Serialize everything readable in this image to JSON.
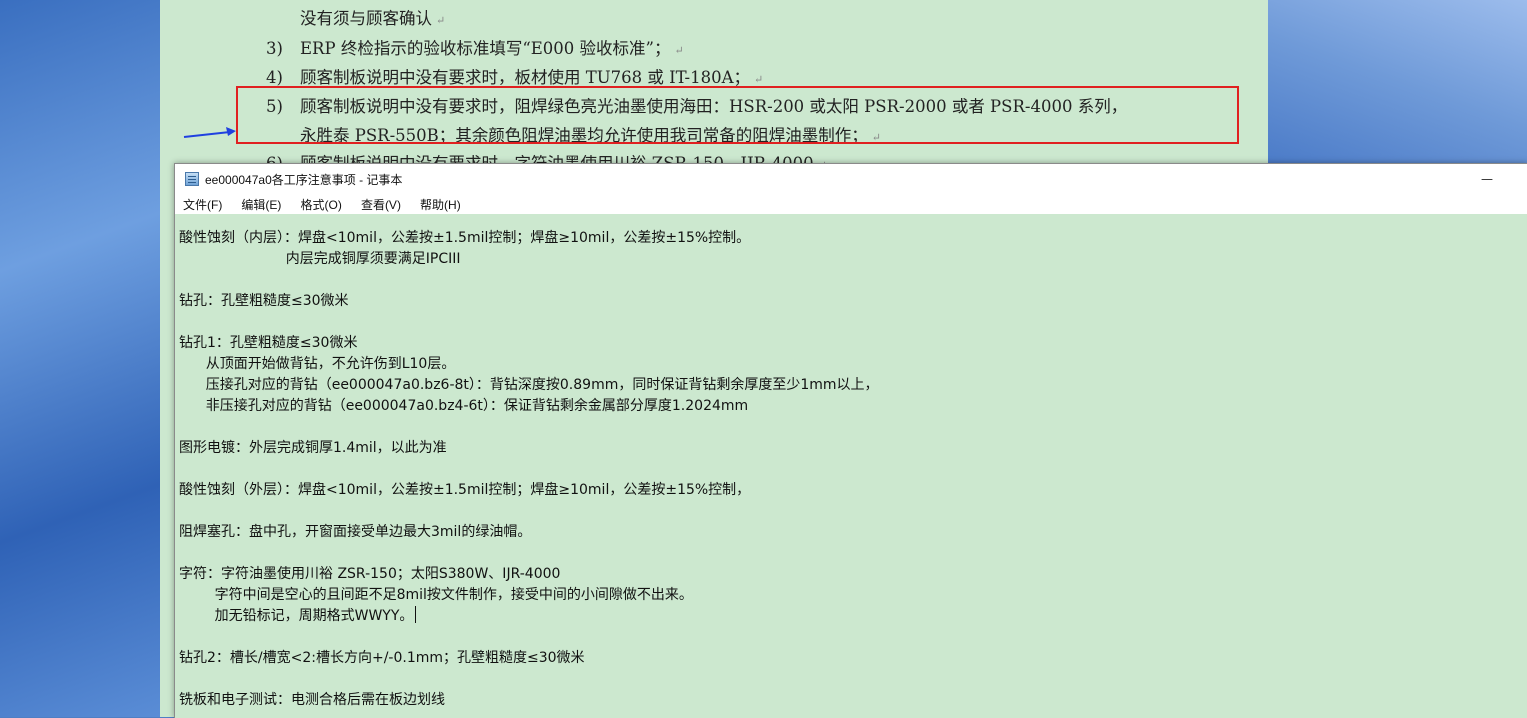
{
  "document": {
    "lines": [
      {
        "num": "",
        "text": "没有须与顾客确认",
        "mark": "↵"
      },
      {
        "num": "3)",
        "text": "ERP 终检指示的验收标准填写“E000 验收标准”；",
        "mark": "↵"
      },
      {
        "num": "4)",
        "text": "顾客制板说明中没有要求时，板材使用 TU768 或 IT-180A；",
        "mark": "↵"
      },
      {
        "num": "5)",
        "text": "顾客制板说明中没有要求时，阻焊绿色亮光油墨使用海田：HSR-200 或太阳 PSR-2000 或者 PSR-4000 系列，",
        "mark": ""
      },
      {
        "num": "",
        "text": "永胜泰 PSR-550B；其余颜色阻焊油墨均允许使用我司常备的阻焊油墨制作；",
        "mark": "↵"
      },
      {
        "num": "6)",
        "text": "顾客制板说明中没有要求时，字符油墨使用川裕 ZSR-150、IJR-4000",
        "mark": "↵"
      }
    ]
  },
  "notepad": {
    "title": "ee000047a0各工序注意事项 - 记事本",
    "minimize_label": "—",
    "menu": [
      "文件(F)",
      "编辑(E)",
      "格式(O)",
      "查看(V)",
      "帮助(H)"
    ],
    "content_lines": [
      "",
      "酸性蚀刻（内层）：焊盘<10mil，公差按±1.5mil控制；焊盘≥10mil，公差按±15%控制。",
      "                        内层完成铜厚须要满足IPCIII",
      "",
      "钻孔：孔壁粗糙度≤30微米",
      "",
      "钻孔1：孔壁粗糙度≤30微米",
      "      从顶面开始做背钻，不允许伤到L10层。",
      "      压接孔对应的背钻（ee000047a0.bz6-8t）：背钻深度按0.89mm，同时保证背钻剩余厚度至少1mm以上，",
      "      非压接孔对应的背钻（ee000047a0.bz4-6t）：保证背钻剩余金属部分厚度1.2024mm",
      "",
      "图形电镀：外层完成铜厚1.4mil，以此为准",
      "",
      "酸性蚀刻（外层）：焊盘<10mil，公差按±1.5mil控制；焊盘≥10mil，公差按±15%控制，",
      "",
      "阻焊塞孔：盘中孔，开窗面接受单边最大3mil的绿油帽。",
      "",
      "字符：字符油墨使用川裕 ZSR-150；太阳S380W、IJR-4000",
      "        字符中间是空心的且间距不足8mil按文件制作，接受中间的小间隙做不出来。",
      "        加无铅标记，周期格式WWYY。",
      "",
      "钻孔2：槽长/槽宽<2:槽长方向+/-0.1mm；孔壁粗糙度≤30微米",
      "",
      "铣板和电子测试：电测合格后需在板边划线"
    ]
  },
  "colors": {
    "eye_protect_green": "#cce8cf",
    "highlight_red": "#e02020",
    "arrow_blue": "#2040e0"
  },
  "icons": [
    "notepad-icon",
    "arrow-icon"
  ]
}
